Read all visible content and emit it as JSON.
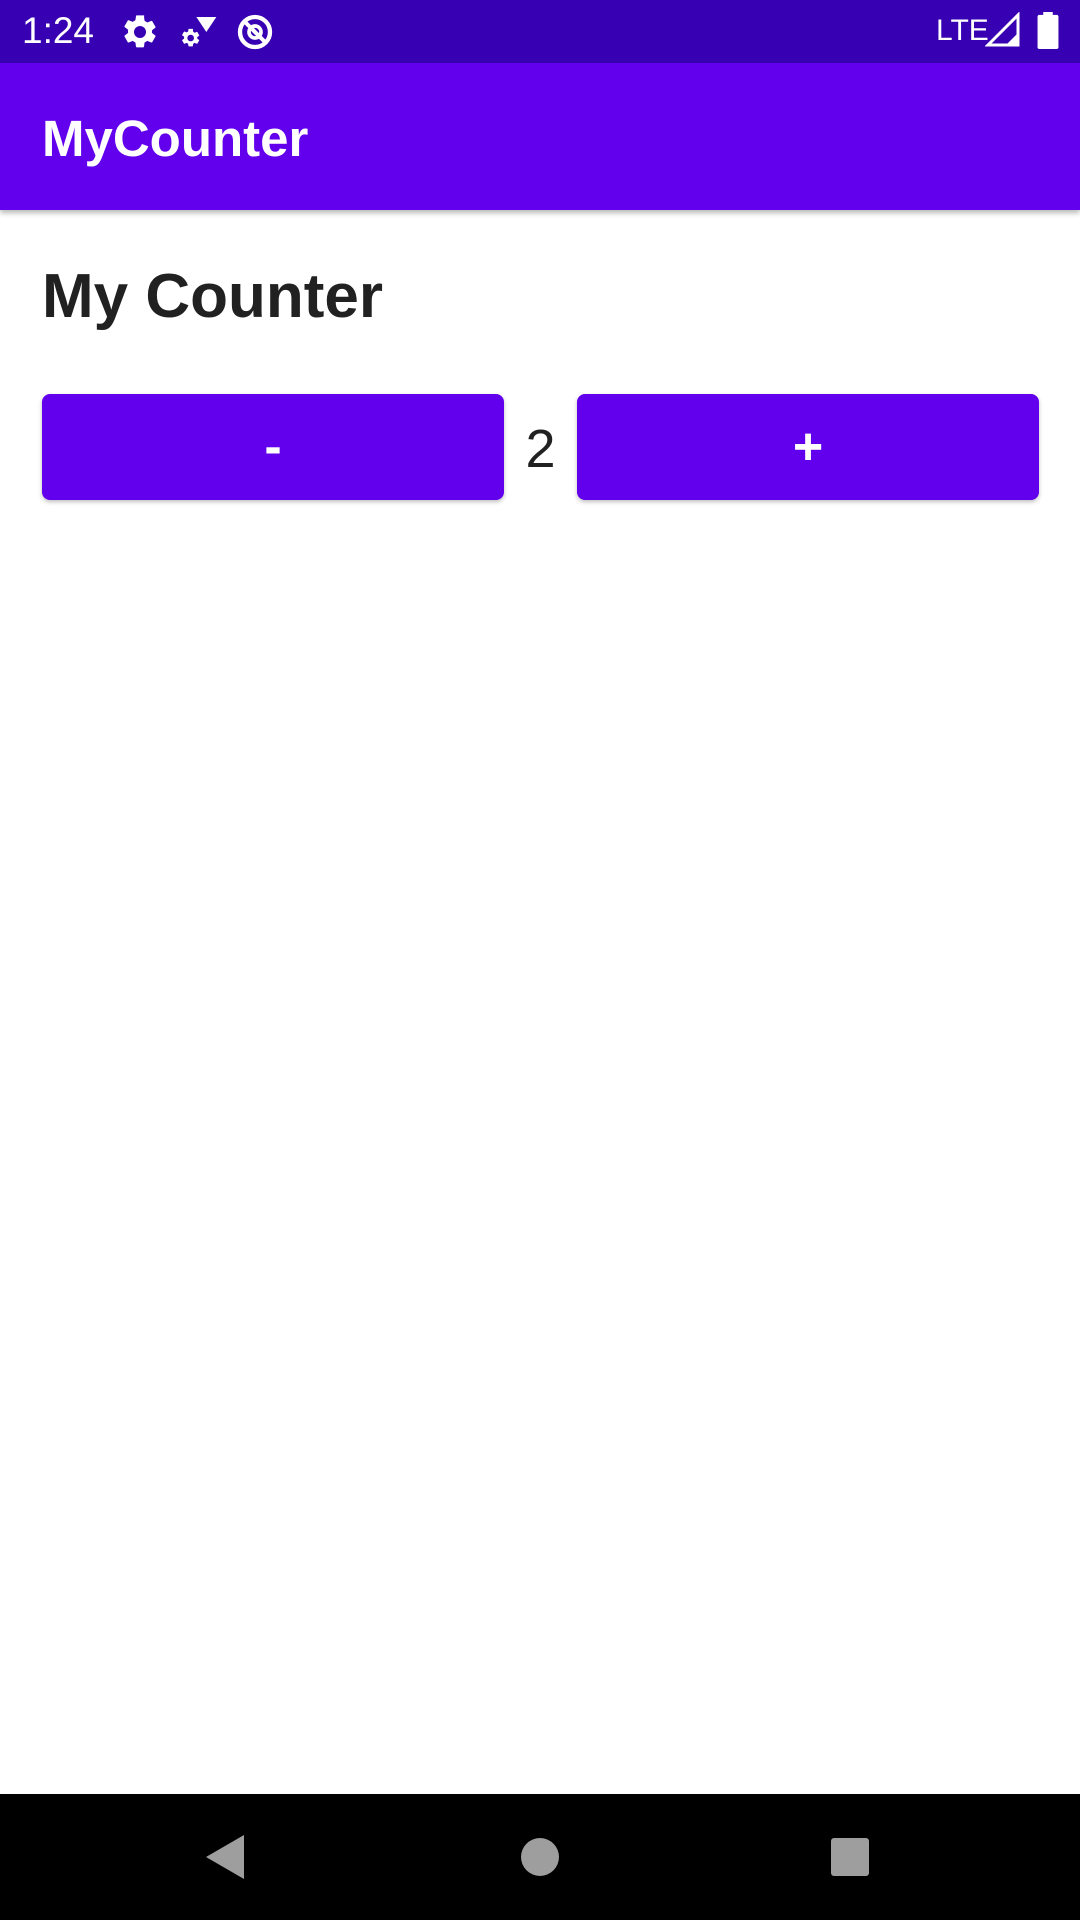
{
  "status_bar": {
    "time": "1:24",
    "network": "LTE",
    "icons": [
      "settings-icon",
      "gear-wifi-icon",
      "no-disturb-icon",
      "signal-icon",
      "battery-icon"
    ],
    "background": "#3700b3"
  },
  "app_bar": {
    "title": "MyCounter",
    "background": "#6200ee"
  },
  "main": {
    "heading": "My Counter",
    "decrement_label": "-",
    "increment_label": "+",
    "count": "2",
    "button_color": "#6200ee"
  },
  "nav_bar": {
    "icons": [
      "back-icon",
      "home-icon",
      "recents-icon"
    ]
  }
}
